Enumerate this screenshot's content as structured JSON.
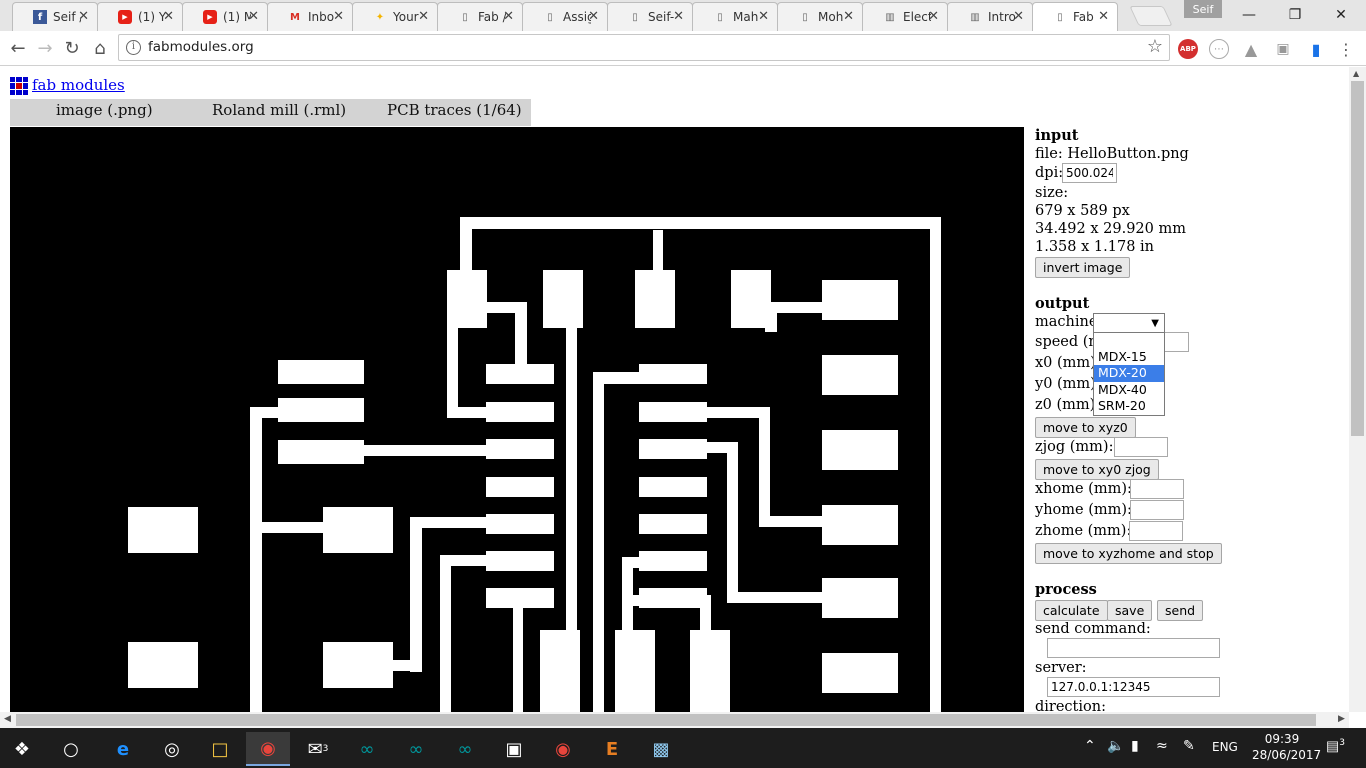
{
  "browser": {
    "tabs": [
      {
        "title": "Seif /",
        "icon": "facebook-icon",
        "color": "#3b5998"
      },
      {
        "title": "(1) Y",
        "icon": "youtube-icon",
        "color": "#e62117"
      },
      {
        "title": "(1) M",
        "icon": "youtube-icon",
        "color": "#e62117"
      },
      {
        "title": "Inbo",
        "icon": "gmail-icon",
        "color": "#d93025"
      },
      {
        "title": "Your",
        "icon": "handshake-icon",
        "color": "#f4b400"
      },
      {
        "title": "Fab /",
        "icon": "document-icon",
        "color": "#666666"
      },
      {
        "title": "Assig",
        "icon": "document-icon",
        "color": "#666666"
      },
      {
        "title": "Seif-",
        "icon": "document-icon",
        "color": "#666666"
      },
      {
        "title": "Mah",
        "icon": "document-icon",
        "color": "#666666"
      },
      {
        "title": "Moh",
        "icon": "document-icon",
        "color": "#666666"
      },
      {
        "title": "Elect",
        "icon": "book-icon",
        "color": "#666666"
      },
      {
        "title": "Intro",
        "icon": "book-icon",
        "color": "#666666"
      },
      {
        "title": "Fab",
        "icon": "document-icon",
        "color": "#666666"
      }
    ],
    "profile": "Seif",
    "url": "fabmodules.org"
  },
  "page": {
    "link": "fab modules",
    "format_tabs": [
      "image (.png)",
      "Roland mill (.rml)",
      "PCB traces (1/64)"
    ]
  },
  "input": {
    "heading": "input",
    "file": "file: HelloButton.png",
    "dpi_label": "dpi:",
    "dpi_value": "500.024",
    "size_label": "size:",
    "size_px": "679 x 589 px",
    "size_mm": "34.492 x 29.920 mm",
    "size_in": "1.358 x 1.178 in",
    "invert_button": "invert image"
  },
  "output": {
    "heading": "output",
    "machine_label": "machine",
    "machine_options": [
      "MDX-15",
      "MDX-20",
      "MDX-40",
      "SRM-20"
    ],
    "selected_option": "MDX-20",
    "speed_label": "speed (m",
    "x0_label": "x0 (mm):",
    "y0_label": "y0 (mm):",
    "z0_label": "z0 (mm):",
    "move_xyz0": "move to xyz0",
    "zjog_label": "zjog (mm):",
    "move_xy0_zjog": "move to xy0 zjog",
    "xhome_label": "xhome (mm):",
    "yhome_label": "yhome (mm):",
    "zhome_label": "zhome (mm):",
    "move_home": "move to xyzhome and stop"
  },
  "process": {
    "heading": "process",
    "calculate": "calculate",
    "save": "save",
    "send": "send",
    "send_command_label": "send command:",
    "server_label": "server:",
    "server_value": "127.0.0.1:12345",
    "direction_label": "direction:"
  },
  "taskbar": {
    "time": "09:39",
    "date": "28/06/2017",
    "language": "ENG",
    "mail_badge": "3",
    "notification_badge": "3"
  }
}
